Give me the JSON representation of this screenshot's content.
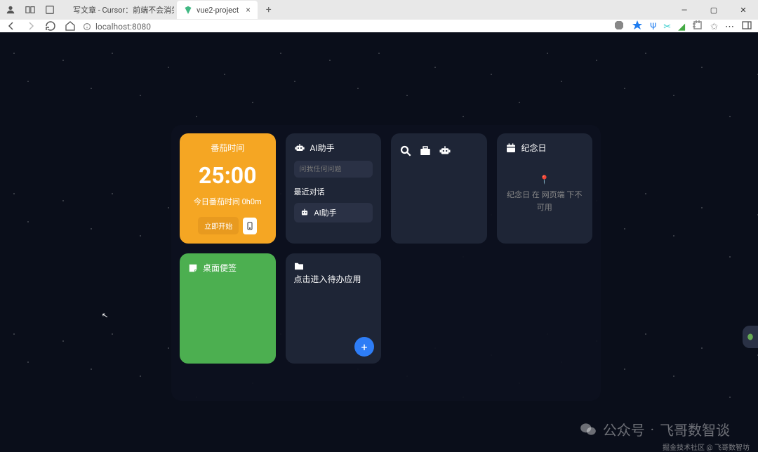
{
  "browser": {
    "tabs": [
      {
        "title": "写文章 - Cursor：前端不会消失，",
        "active": false
      },
      {
        "title": "vue2-project",
        "active": true
      }
    ],
    "url": "localhost:8080"
  },
  "pomodoro": {
    "title": "番茄时间",
    "time": "25:00",
    "today_label": "今日番茄时间 0h0m",
    "start_label": "立即开始"
  },
  "ai": {
    "title": "AI助手",
    "placeholder": "问我任何问题",
    "recent_label": "最近对话",
    "recent_item": "AI助手"
  },
  "anniversary": {
    "title": "纪念日",
    "message": "纪念日 在 网页端 下不可用"
  },
  "sticky": {
    "title": "桌面便签"
  },
  "todo": {
    "title": "点击进入待办应用"
  },
  "watermark": {
    "label": "公众号",
    "name": "飞哥数智谈"
  },
  "credit": "掘金技术社区 @ 飞哥数智坊"
}
